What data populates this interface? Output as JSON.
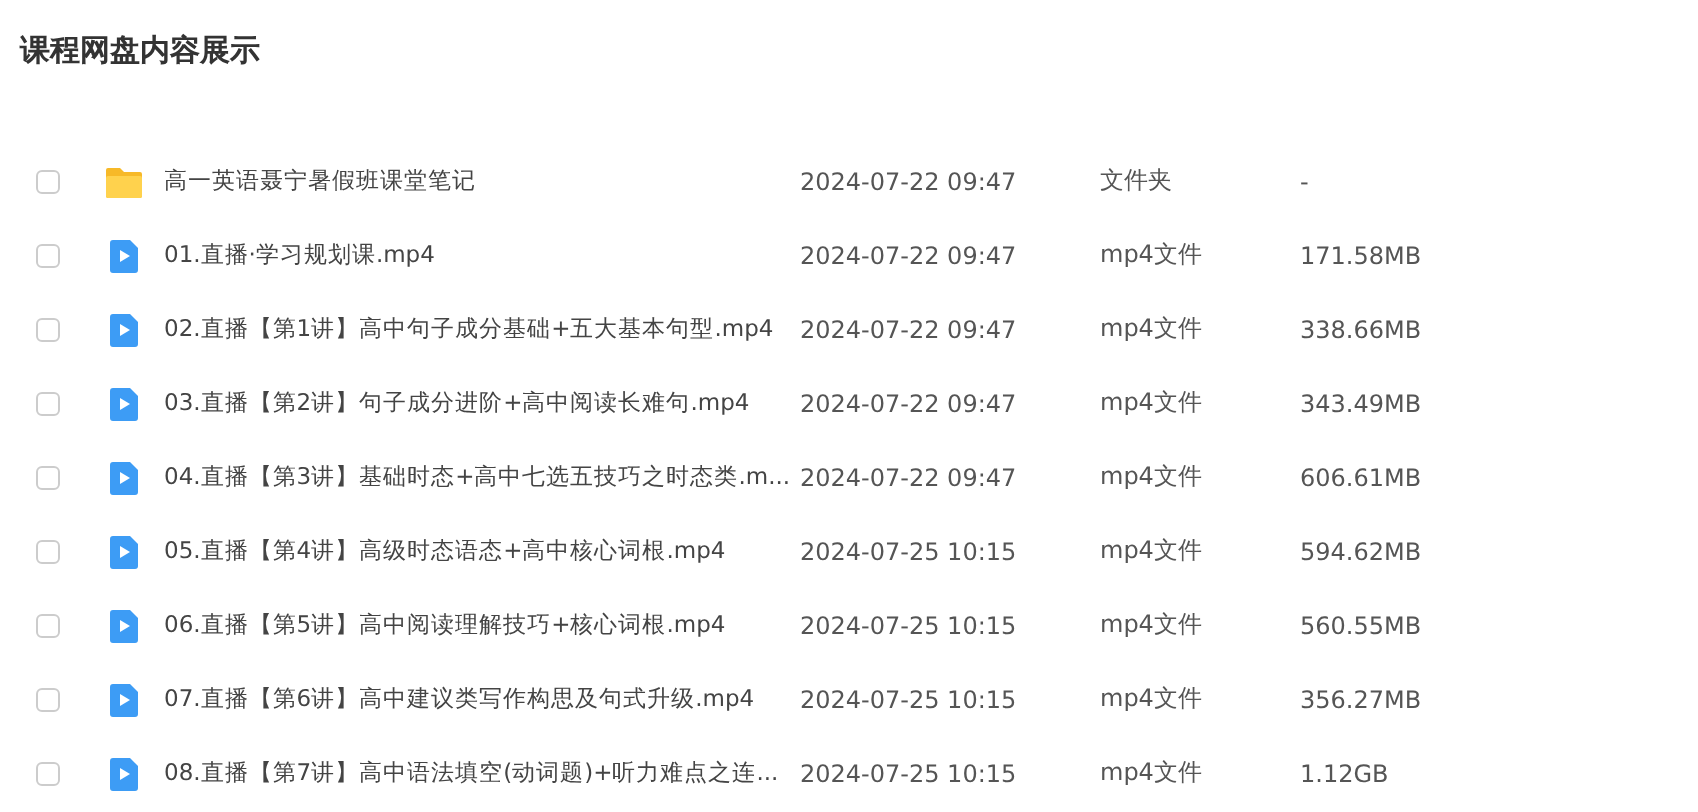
{
  "title": "课程网盘内容展示",
  "files": [
    {
      "kind": "folder",
      "checked": false,
      "name": "高一英语聂宁暑假班课堂笔记",
      "date": "2024-07-22 09:47",
      "type": "文件夹",
      "size": "-"
    },
    {
      "kind": "video",
      "checked": false,
      "name": "01.直播·学习规划课.mp4",
      "date": "2024-07-22 09:47",
      "type": "mp4文件",
      "size": "171.58MB"
    },
    {
      "kind": "video",
      "checked": false,
      "name": "02.直播【第1讲】高中句子成分基础+五大基本句型.mp4",
      "date": "2024-07-22 09:47",
      "type": "mp4文件",
      "size": "338.66MB"
    },
    {
      "kind": "video",
      "checked": false,
      "name": "03.直播【第2讲】句子成分进阶+高中阅读长难句.mp4",
      "date": "2024-07-22 09:47",
      "type": "mp4文件",
      "size": "343.49MB"
    },
    {
      "kind": "video",
      "checked": false,
      "name": "04.直播【第3讲】基础时态+高中七选五技巧之时态类.m...",
      "date": "2024-07-22 09:47",
      "type": "mp4文件",
      "size": "606.61MB"
    },
    {
      "kind": "video",
      "checked": false,
      "name": "05.直播【第4讲】高级时态语态+高中核心词根.mp4",
      "date": "2024-07-25 10:15",
      "type": "mp4文件",
      "size": "594.62MB"
    },
    {
      "kind": "video",
      "checked": false,
      "name": "06.直播【第5讲】高中阅读理解技巧+核心词根.mp4",
      "date": "2024-07-25 10:15",
      "type": "mp4文件",
      "size": "560.55MB"
    },
    {
      "kind": "video",
      "checked": false,
      "name": "07.直播【第6讲】高中建议类写作构思及句式升级.mp4",
      "date": "2024-07-25 10:15",
      "type": "mp4文件",
      "size": "356.27MB"
    },
    {
      "kind": "video",
      "checked": false,
      "name": "08.直播【第7讲】高中语法填空(动词题)+听力难点之连...",
      "date": "2024-07-25 10:15",
      "type": "mp4文件",
      "size": "1.12GB"
    }
  ]
}
